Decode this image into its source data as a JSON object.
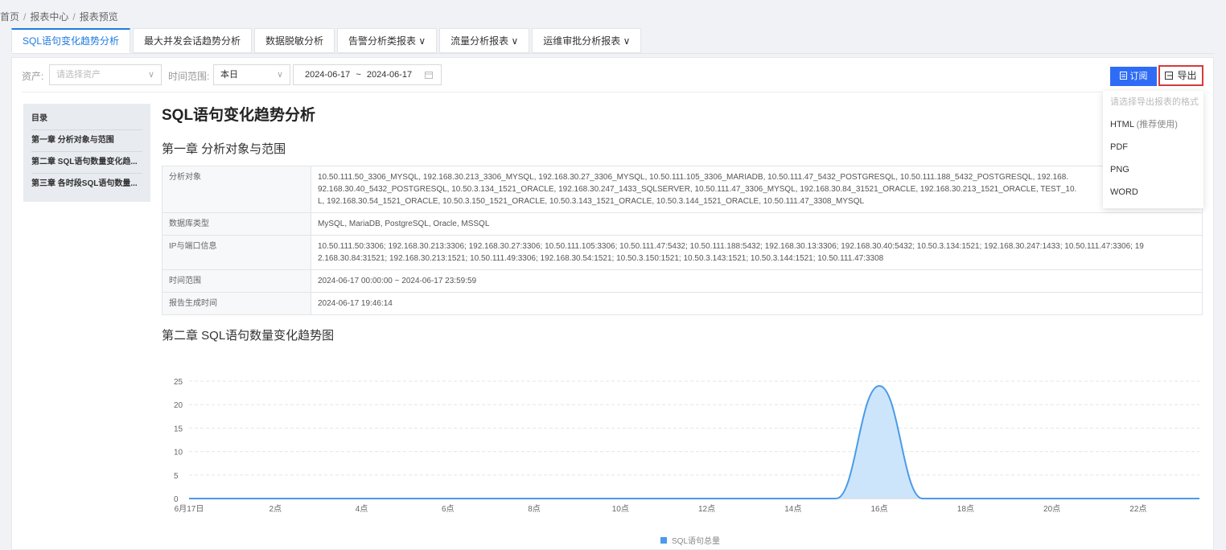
{
  "breadcrumb": [
    "首页",
    "报表中心",
    "报表预览"
  ],
  "tabs": [
    {
      "label": "SQL语句变化趋势分析",
      "active": true
    },
    {
      "label": "最大并发会话趋势分析"
    },
    {
      "label": "数据脱敏分析"
    },
    {
      "label": "告警分析类报表 ∨"
    },
    {
      "label": "流量分析报表 ∨"
    },
    {
      "label": "运维审批分析报表 ∨"
    }
  ],
  "filter": {
    "asset_label": "资产:",
    "asset_placeholder": "请选择资产",
    "time_label": "时间范围:",
    "time_value": "本日",
    "date_start": "2024-06-17",
    "date_sep": "~",
    "date_end": "2024-06-17"
  },
  "actions": {
    "subscribe": "订阅",
    "export": "导出"
  },
  "toc": {
    "title": "目录",
    "items": [
      "第一章 分析对象与范围",
      "第二章 SQL语句数量变化趋...",
      "第三章 各时段SQL语句数量..."
    ]
  },
  "report": {
    "title": "SQL语句变化趋势分析",
    "chapter1": "第一章 分析对象与范围",
    "chapter2": "第二章 SQL语句数量变化趋势图",
    "rows": [
      {
        "key": "分析对象",
        "value": "10.50.111.50_3306_MYSQL, 192.168.30.213_3306_MYSQL, 192.168.30.27_3306_MYSQL, 10.50.111.105_3306_MARIADB, 10.50.111.47_5432_POSTGRESQL, 10.50.111.188_5432_POSTGRESQL, 192.168.",
        "value2": "92.168.30.40_5432_POSTGRESQL, 10.50.3.134_1521_ORACLE, 192.168.30.247_1433_SQLSERVER, 10.50.111.47_3306_MYSQL, 192.168.30.84_31521_ORACLE, 192.168.30.213_1521_ORACLE, TEST_10.",
        "value3": "L, 192.168.30.54_1521_ORACLE, 10.50.3.150_1521_ORACLE, 10.50.3.143_1521_ORACLE, 10.50.3.144_1521_ORACLE, 10.50.111.47_3308_MYSQL"
      },
      {
        "key": "数据库类型",
        "value": "MySQL, MariaDB, PostgreSQL, Oracle, MSSQL"
      },
      {
        "key": "IP与端口信息",
        "value": "10.50.111.50:3306; 192.168.30.213:3306; 192.168.30.27:3306; 10.50.111.105:3306; 10.50.111.47:5432; 10.50.111.188:5432; 192.168.30.13:3306; 192.168.30.40:5432; 10.50.3.134:1521; 192.168.30.247:1433; 10.50.111.47:3306; 19",
        "value2": "2.168.30.84:31521; 192.168.30.213:1521; 10.50.111.49:3306; 192.168.30.54:1521; 10.50.3.150:1521; 10.50.3.143:1521; 10.50.3.144:1521; 10.50.111.47:3308"
      },
      {
        "key": "时间范围",
        "value": "2024-06-17 00:00:00 ~ 2024-06-17 23:59:59"
      },
      {
        "key": "报告生成时间",
        "value": "2024-06-17 19:46:14"
      }
    ]
  },
  "export_menu": {
    "hint": "请选择导出报表的格式",
    "items": [
      {
        "label": "HTML",
        "sub": "(推荐使用)"
      },
      {
        "label": "PDF"
      },
      {
        "label": "PNG"
      },
      {
        "label": "WORD"
      }
    ]
  },
  "chart_data": {
    "type": "area",
    "x": [
      "6月17日",
      "1点",
      "2点",
      "3点",
      "4点",
      "5点",
      "6点",
      "7点",
      "8点",
      "9点",
      "10点",
      "11点",
      "12点",
      "13点",
      "14点",
      "15点",
      "16点",
      "17点",
      "18点",
      "19点",
      "20点",
      "21点",
      "22点",
      "23点"
    ],
    "xtick_labels": [
      "6月17日",
      "2点",
      "4点",
      "6点",
      "8点",
      "10点",
      "12点",
      "14点",
      "16点",
      "18点",
      "20点",
      "22点"
    ],
    "series": [
      {
        "name": "SQL语句总量",
        "values": [
          0,
          0,
          0,
          0,
          0,
          0,
          0,
          0,
          0,
          0,
          0,
          0,
          0,
          0,
          0,
          0,
          24,
          0,
          0,
          0,
          0,
          0,
          0,
          0
        ]
      }
    ],
    "yticks": [
      0,
      5,
      10,
      15,
      20,
      25
    ],
    "ylim": [
      0,
      25
    ],
    "grid": true,
    "legend": "bottom",
    "colors": {
      "line": "#4a9be8",
      "fill": "#c8e2fb"
    }
  }
}
